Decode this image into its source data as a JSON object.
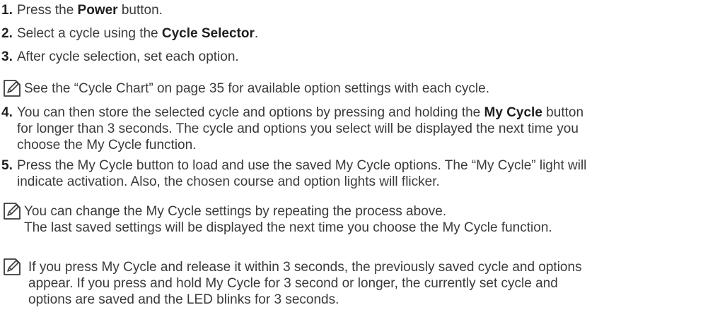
{
  "steps": [
    {
      "num": "1.",
      "pre": "Press the ",
      "bold": "Power",
      "post": " button."
    },
    {
      "num": "2.",
      "pre": "Select a cycle using the ",
      "bold": "Cycle Selector",
      "post": "."
    },
    {
      "num": "3.",
      "text": "After cycle selection, set each option."
    },
    {
      "num": "4.",
      "line1_pre": "You can then store the selected cycle and options by pressing and holding the ",
      "line1_bold": "My Cycle",
      "line1_post": " button",
      "line2": "for longer than 3 seconds. The cycle and options you select will be displayed the next time you",
      "line3": "choose the My Cycle function."
    },
    {
      "num": "5.",
      "line1": "Press the My Cycle button to load and use the saved My Cycle options. The “My Cycle” light will",
      "line2": "indicate activation. Also, the chosen course and option lights will flicker."
    }
  ],
  "notes": [
    {
      "icon": "note-pencil-icon",
      "lines": [
        "See the “Cycle Chart” on page 35 for available option settings with each cycle."
      ]
    },
    {
      "icon": "note-pencil-icon",
      "lines": [
        "You can change the My Cycle settings by repeating the process above.",
        "The last saved settings will be displayed the next time you choose the My Cycle function."
      ]
    },
    {
      "icon": "note-pencil-icon",
      "lines": [
        "If you press My Cycle and release it within 3 seconds, the previously saved cycle and options",
        "appear. If you press and hold My Cycle for 3 second or longer, the currently set cycle and",
        "options are saved and the LED blinks for 3 seconds."
      ]
    }
  ]
}
